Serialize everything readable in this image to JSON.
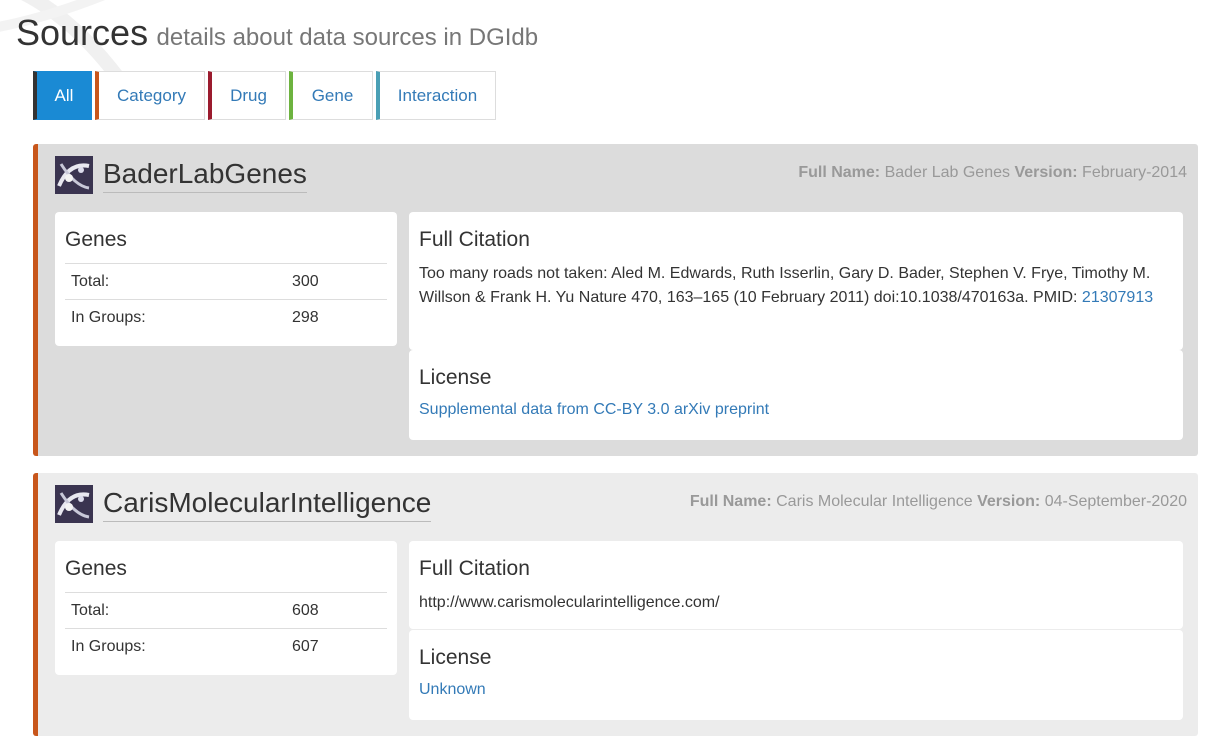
{
  "header": {
    "title": "Sources",
    "subtitle": "details about data sources in DGIdb"
  },
  "tabs": [
    {
      "label": "All",
      "active": true,
      "accent": "#333333"
    },
    {
      "label": "Category",
      "active": false,
      "accent": "#c8561b"
    },
    {
      "label": "Drug",
      "active": false,
      "accent": "#9b1b2e"
    },
    {
      "label": "Gene",
      "active": false,
      "accent": "#6db33f"
    },
    {
      "label": "Interaction",
      "active": false,
      "accent": "#4a9fb5"
    }
  ],
  "sources": [
    {
      "name": "BaderLabGenes",
      "full_name_label": "Full Name:",
      "full_name": "Bader Lab Genes",
      "version_label": "Version:",
      "version": "February-2014",
      "genes": {
        "title": "Genes",
        "rows": [
          {
            "label": "Total:",
            "value": "300"
          },
          {
            "label": "In Groups:",
            "value": "298"
          }
        ]
      },
      "citation": {
        "title": "Full Citation",
        "text": "Too many roads not taken: Aled M. Edwards, Ruth Isserlin, Gary D. Bader, Stephen V. Frye, Timothy M. Willson & Frank H. Yu Nature 470, 163–165 (10 February 2011) doi:10.1038/470163a. PMID: ",
        "link": "21307913"
      },
      "license": {
        "title": "License",
        "text": "Supplemental data from CC-BY 3.0 arXiv preprint"
      }
    },
    {
      "name": "CarisMolecularIntelligence",
      "full_name_label": "Full Name:",
      "full_name": "Caris Molecular Intelligence",
      "version_label": "Version:",
      "version": "04-September-2020",
      "genes": {
        "title": "Genes",
        "rows": [
          {
            "label": "Total:",
            "value": "608"
          },
          {
            "label": "In Groups:",
            "value": "607"
          }
        ]
      },
      "citation": {
        "title": "Full Citation",
        "text": "http://www.carismolecularintelligence.com/",
        "link": ""
      },
      "license": {
        "title": "License",
        "text": "Unknown"
      }
    }
  ]
}
